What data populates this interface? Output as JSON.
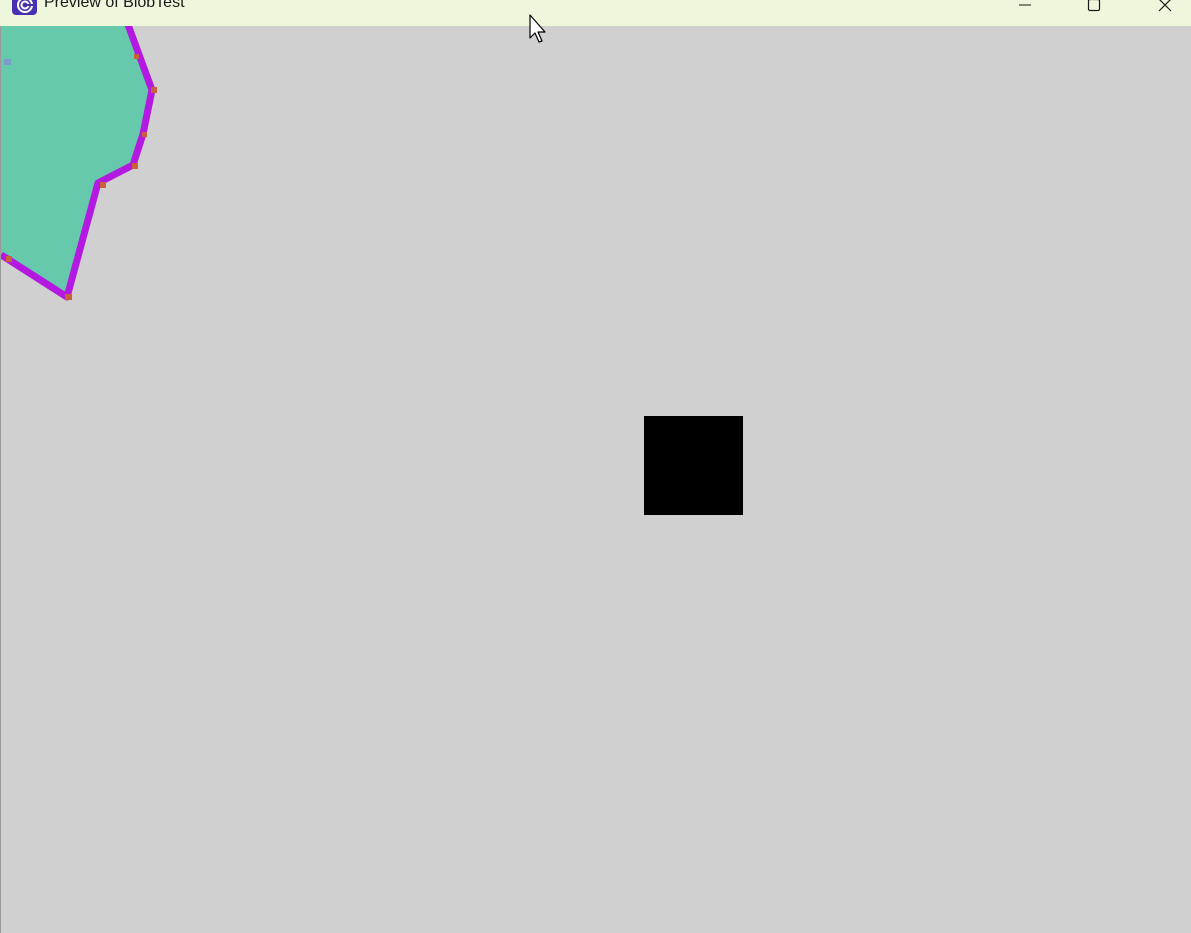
{
  "window": {
    "title": "Preview of BlobTest"
  },
  "icons": {
    "app": "app-logo-icon",
    "minimize": "minimize-icon",
    "maximize": "maximize-icon",
    "close": "close-icon",
    "cursor": "mouse-pointer-icon"
  },
  "colors": {
    "titlebar": "#eef7dc",
    "canvas_background": "#d0d0d0",
    "blob_fill": "#66c9ac",
    "blob_outline": "#b319e0",
    "blob_vertex": "#c8603a",
    "square": "#000000"
  }
}
